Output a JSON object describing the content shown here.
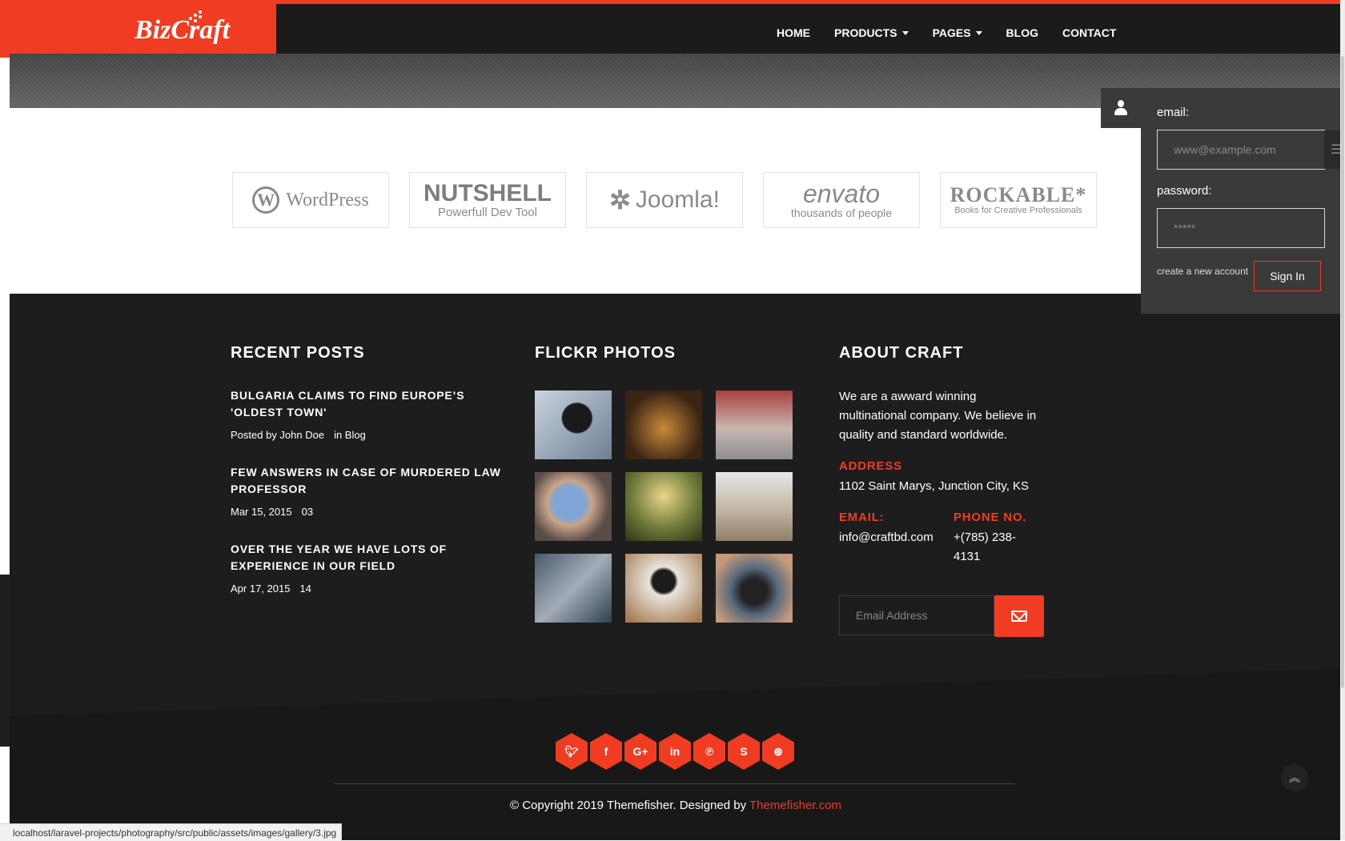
{
  "header": {
    "logo_text": "BizCraft",
    "nav": [
      {
        "label": "HOME"
      },
      {
        "label": "PRODUCTS"
      },
      {
        "label": "PAGES"
      },
      {
        "label": "BLOG"
      },
      {
        "label": "CONTACT"
      }
    ]
  },
  "clients": [
    {
      "title": "WordPress",
      "subtitle": ""
    },
    {
      "title": "NUTSHELL",
      "subtitle": "Powerfull Dev Tool"
    },
    {
      "title": "Joomla!",
      "subtitle": ""
    },
    {
      "title": "envato",
      "subtitle": "thousands of people"
    },
    {
      "title": "ROCKABLE*",
      "subtitle": "Books for Creative Professionals"
    }
  ],
  "login": {
    "email_label": "email:",
    "email_placeholder": "www@example.com",
    "password_label": "password:",
    "password_placeholder": "*****",
    "create_account": "create a new account",
    "signin": "Sign In"
  },
  "footer": {
    "recent_posts_title": "RECENT POSTS",
    "posts": [
      {
        "title": "BULGARIA CLAIMS TO FIND EUROPE’S 'OLDEST TOWN'",
        "meta1": "Posted by John Doe",
        "meta2": "in Blog"
      },
      {
        "title": "FEW ANSWERS IN CASE OF MURDERED LAW PROFESSOR",
        "meta1": "Mar 15, 2015",
        "meta2": "03"
      },
      {
        "title": "OVER THE YEAR WE HAVE LOTS OF EXPERIENCE IN OUR FIELD",
        "meta1": "Apr 17, 2015",
        "meta2": "14"
      }
    ],
    "flickr_title": "FLICKR PHOTOS",
    "about_title": "ABOUT CRAFT",
    "about_text": "We are a awward winning multinational company. We believe in quality and standard worldwide.",
    "address_label": "ADDRESS",
    "address": "1102 Saint Marys, Junction City, KS",
    "email_label": "EMAIL:",
    "email": "info@craftbd.com",
    "phone_label": "PHONE NO.",
    "phone": "+(785) 238-4131",
    "subscribe_placeholder": "Email Address",
    "socials": [
      "twitter-icon",
      "facebook-icon",
      "google-plus-icon",
      "linkedin-icon",
      "pinterest-icon",
      "skype-icon",
      "dribbble-icon"
    ],
    "copyright_text": "© Copyright 2019 Themefisher. Designed by",
    "copyright_brand": "Themefisher.com"
  },
  "status_url": "localhost/laravel-projects/photography/src/public/assets/images/gallery/3.jpg",
  "colors": {
    "accent": "#ef3c23",
    "dark": "#1d1d1d"
  }
}
